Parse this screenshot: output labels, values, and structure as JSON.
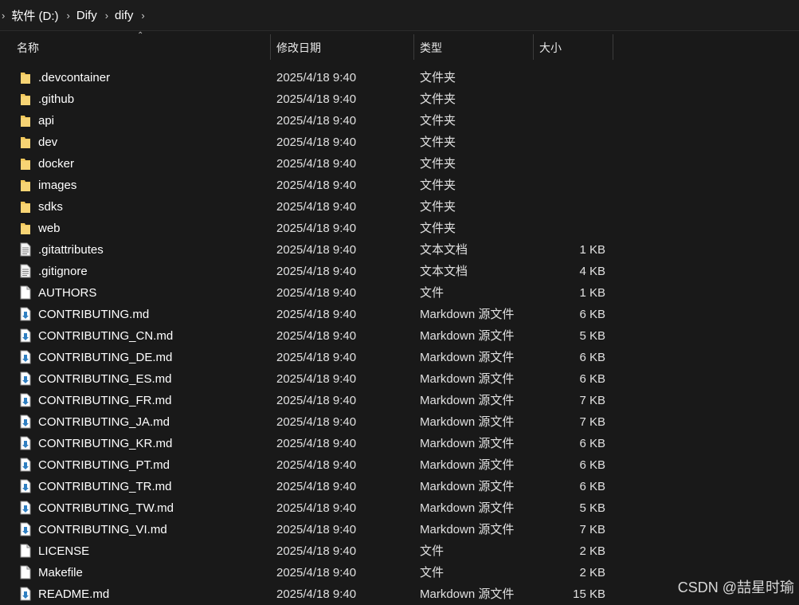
{
  "breadcrumb": [
    "软件 (D:)",
    "Dify",
    "dify"
  ],
  "columns": {
    "name": "名称",
    "date": "修改日期",
    "type": "类型",
    "size": "大小"
  },
  "files": [
    {
      "icon": "folder-icon",
      "name": ".devcontainer",
      "date": "2025/4/18 9:40",
      "type": "文件夹",
      "size": ""
    },
    {
      "icon": "folder-icon",
      "name": ".github",
      "date": "2025/4/18 9:40",
      "type": "文件夹",
      "size": ""
    },
    {
      "icon": "folder-icon",
      "name": "api",
      "date": "2025/4/18 9:40",
      "type": "文件夹",
      "size": ""
    },
    {
      "icon": "folder-icon",
      "name": "dev",
      "date": "2025/4/18 9:40",
      "type": "文件夹",
      "size": ""
    },
    {
      "icon": "folder-icon",
      "name": "docker",
      "date": "2025/4/18 9:40",
      "type": "文件夹",
      "size": ""
    },
    {
      "icon": "folder-icon",
      "name": "images",
      "date": "2025/4/18 9:40",
      "type": "文件夹",
      "size": ""
    },
    {
      "icon": "folder-icon",
      "name": "sdks",
      "date": "2025/4/18 9:40",
      "type": "文件夹",
      "size": ""
    },
    {
      "icon": "folder-icon",
      "name": "web",
      "date": "2025/4/18 9:40",
      "type": "文件夹",
      "size": ""
    },
    {
      "icon": "text-file-icon",
      "name": ".gitattributes",
      "date": "2025/4/18 9:40",
      "type": "文本文档",
      "size": "1 KB"
    },
    {
      "icon": "text-file-icon",
      "name": ".gitignore",
      "date": "2025/4/18 9:40",
      "type": "文本文档",
      "size": "4 KB"
    },
    {
      "icon": "blank-file-icon",
      "name": "AUTHORS",
      "date": "2025/4/18 9:40",
      "type": "文件",
      "size": "1 KB"
    },
    {
      "icon": "markdown-file-icon",
      "name": "CONTRIBUTING.md",
      "date": "2025/4/18 9:40",
      "type": "Markdown 源文件",
      "size": "6 KB"
    },
    {
      "icon": "markdown-file-icon",
      "name": "CONTRIBUTING_CN.md",
      "date": "2025/4/18 9:40",
      "type": "Markdown 源文件",
      "size": "5 KB"
    },
    {
      "icon": "markdown-file-icon",
      "name": "CONTRIBUTING_DE.md",
      "date": "2025/4/18 9:40",
      "type": "Markdown 源文件",
      "size": "6 KB"
    },
    {
      "icon": "markdown-file-icon",
      "name": "CONTRIBUTING_ES.md",
      "date": "2025/4/18 9:40",
      "type": "Markdown 源文件",
      "size": "6 KB"
    },
    {
      "icon": "markdown-file-icon",
      "name": "CONTRIBUTING_FR.md",
      "date": "2025/4/18 9:40",
      "type": "Markdown 源文件",
      "size": "7 KB"
    },
    {
      "icon": "markdown-file-icon",
      "name": "CONTRIBUTING_JA.md",
      "date": "2025/4/18 9:40",
      "type": "Markdown 源文件",
      "size": "7 KB"
    },
    {
      "icon": "markdown-file-icon",
      "name": "CONTRIBUTING_KR.md",
      "date": "2025/4/18 9:40",
      "type": "Markdown 源文件",
      "size": "6 KB"
    },
    {
      "icon": "markdown-file-icon",
      "name": "CONTRIBUTING_PT.md",
      "date": "2025/4/18 9:40",
      "type": "Markdown 源文件",
      "size": "6 KB"
    },
    {
      "icon": "markdown-file-icon",
      "name": "CONTRIBUTING_TR.md",
      "date": "2025/4/18 9:40",
      "type": "Markdown 源文件",
      "size": "6 KB"
    },
    {
      "icon": "markdown-file-icon",
      "name": "CONTRIBUTING_TW.md",
      "date": "2025/4/18 9:40",
      "type": "Markdown 源文件",
      "size": "5 KB"
    },
    {
      "icon": "markdown-file-icon",
      "name": "CONTRIBUTING_VI.md",
      "date": "2025/4/18 9:40",
      "type": "Markdown 源文件",
      "size": "7 KB"
    },
    {
      "icon": "blank-file-icon",
      "name": "LICENSE",
      "date": "2025/4/18 9:40",
      "type": "文件",
      "size": "2 KB"
    },
    {
      "icon": "blank-file-icon",
      "name": "Makefile",
      "date": "2025/4/18 9:40",
      "type": "文件",
      "size": "2 KB"
    },
    {
      "icon": "markdown-file-icon",
      "name": "README.md",
      "date": "2025/4/18 9:40",
      "type": "Markdown 源文件",
      "size": "15 KB"
    }
  ],
  "watermark": "CSDN @喆星时瑜",
  "colors": {
    "background": "#191919",
    "folder": "#f2c85b",
    "markdown_arrow": "#2f7fc1"
  }
}
